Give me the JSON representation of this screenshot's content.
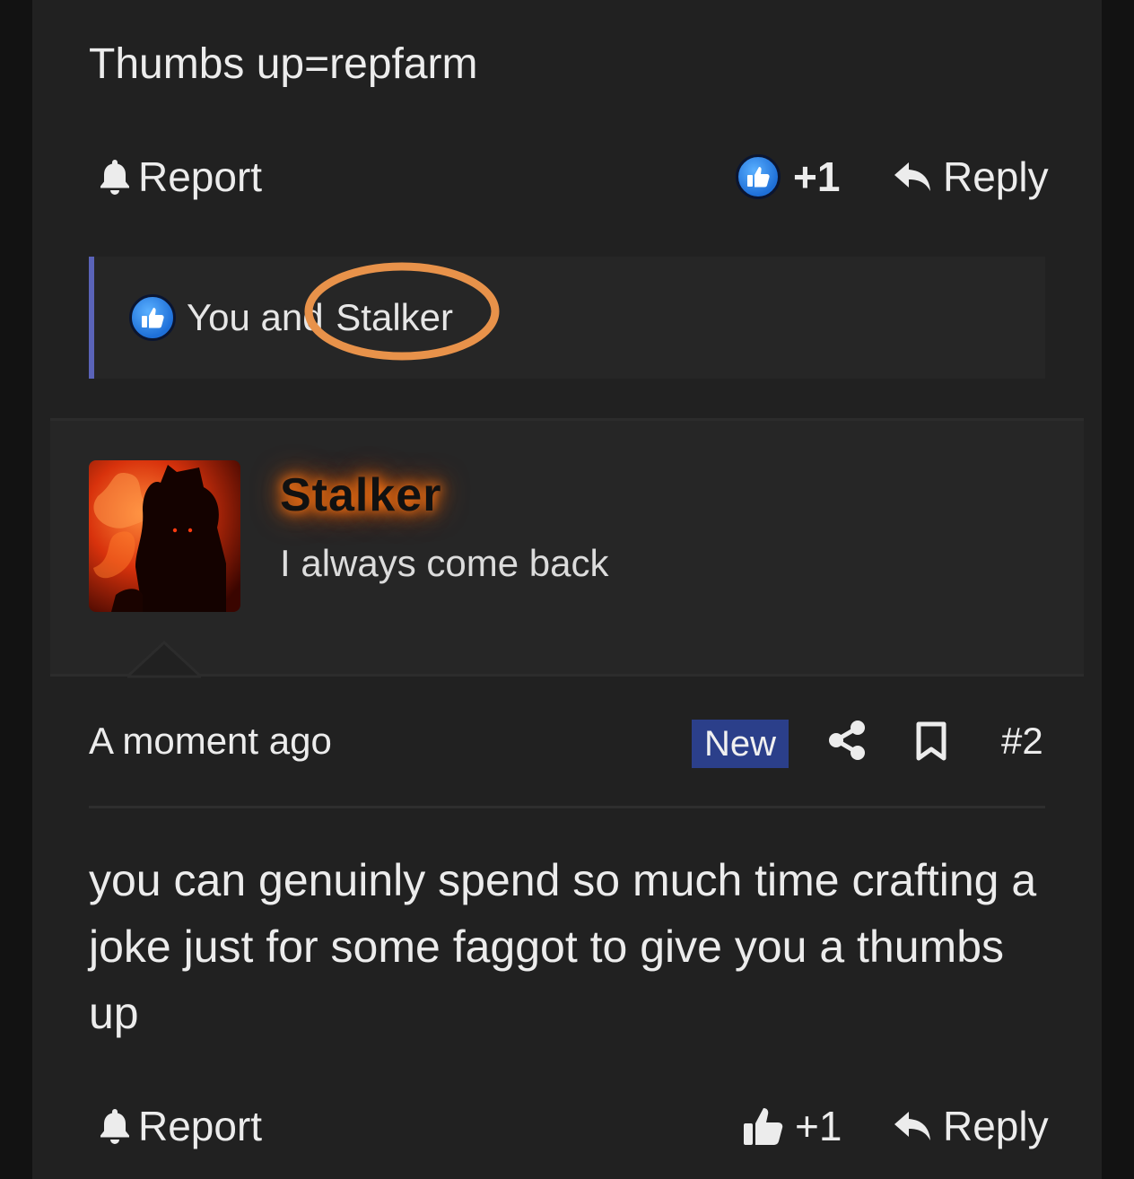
{
  "post1": {
    "text": "Thumbs up=repfarm",
    "report_label": "Report",
    "like_count": "+1",
    "reply_label": "Reply",
    "reaction_prefix": "You and",
    "reaction_user": "Stalker"
  },
  "post2": {
    "username": "Stalker",
    "user_title": "I always come back",
    "timestamp": "A moment ago",
    "new_badge": "New",
    "post_number": "#2",
    "body": "you can genuinly spend so much time crafting a joke just for some faggot to give you a thumbs up",
    "report_label": "Report",
    "like_count": "+1",
    "reply_label": "Reply"
  },
  "colors": {
    "accent_blue": "#2b3f8a",
    "reaction_border": "#5a63b8",
    "highlight_circle": "#e8924a",
    "username_glow": "#ff6a00"
  }
}
